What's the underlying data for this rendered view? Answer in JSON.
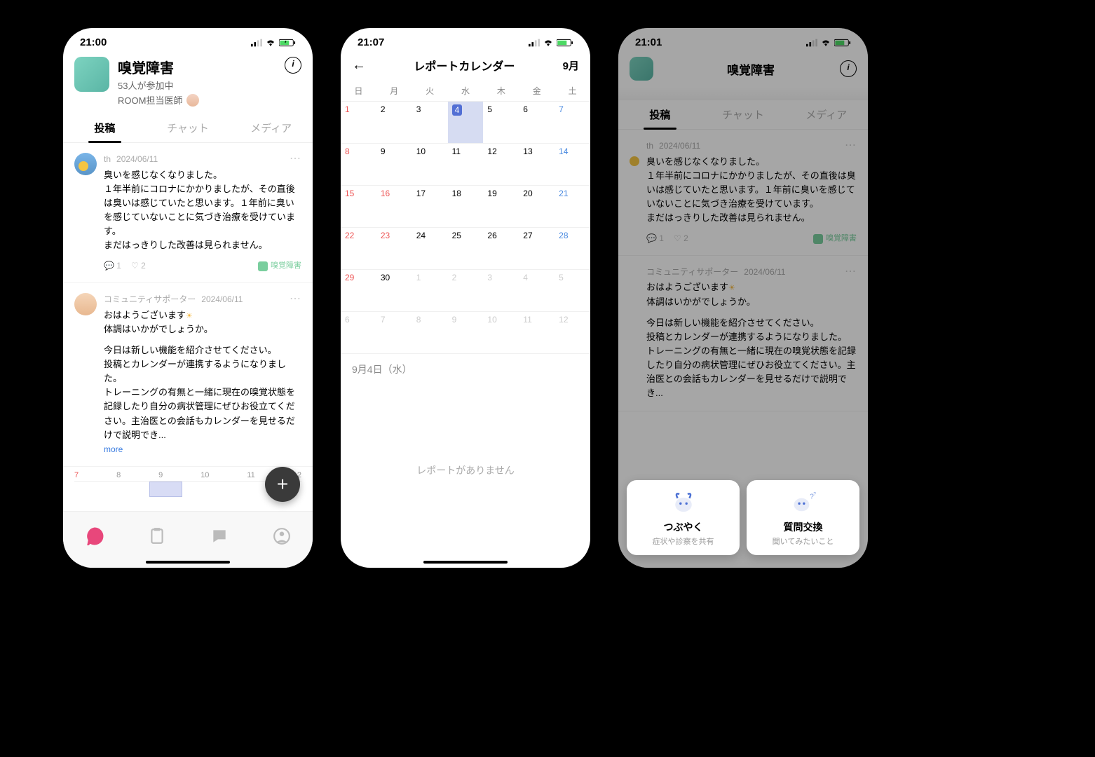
{
  "screen1": {
    "time": "21:00",
    "header": {
      "title": "嗅覚障害",
      "participants": "53人が参加中",
      "doctor_label": "ROOM担当医師"
    },
    "tabs": {
      "posts": "投稿",
      "chat": "チャット",
      "media": "メディア"
    },
    "post1": {
      "author": "th",
      "date": "2024/06/11",
      "line1": "臭いを感じなくなりました。",
      "line2": "１年半前にコロナにかかりましたが、その直後は臭いは感じていたと思います。１年前に臭いを感じていないことに気づき治療を受けています。",
      "line3": "まだはっきりした改善は見られません。",
      "comments": "1",
      "likes": "2",
      "tag": "嗅覚障害"
    },
    "post2": {
      "author": "コミュニティサポーター",
      "date": "2024/06/11",
      "greet": "おはようございます",
      "line2": "体調はいかがでしょうか。",
      "line3": "今日は新しい機能を紹介させてください。",
      "line4": "投稿とカレンダーが連携するようになりました。",
      "line5": "トレーニングの有無と一緒に現在の嗅覚状態を記録したり自分の病状管理にぜひお役立てください。主治医との会話もカレンダーを見せるだけで説明でき...",
      "more": "more"
    },
    "mini_cal": [
      "7",
      "8",
      "9",
      "10",
      "11",
      "12"
    ]
  },
  "screen2": {
    "time": "21:07",
    "title": "レポートカレンダー",
    "month": "9月",
    "dow": [
      "日",
      "月",
      "火",
      "水",
      "木",
      "金",
      "土"
    ],
    "weeks": [
      [
        {
          "n": "1",
          "c": "red"
        },
        {
          "n": "2"
        },
        {
          "n": "3"
        },
        {
          "n": "4",
          "sel": true
        },
        {
          "n": "5"
        },
        {
          "n": "6"
        },
        {
          "n": "7",
          "c": "blue"
        }
      ],
      [
        {
          "n": "8",
          "c": "red"
        },
        {
          "n": "9"
        },
        {
          "n": "10"
        },
        {
          "n": "11"
        },
        {
          "n": "12"
        },
        {
          "n": "13"
        },
        {
          "n": "14",
          "c": "blue"
        }
      ],
      [
        {
          "n": "15",
          "c": "red"
        },
        {
          "n": "16",
          "c": "red"
        },
        {
          "n": "17"
        },
        {
          "n": "18"
        },
        {
          "n": "19"
        },
        {
          "n": "20"
        },
        {
          "n": "21",
          "c": "blue"
        }
      ],
      [
        {
          "n": "22",
          "c": "red"
        },
        {
          "n": "23",
          "c": "red"
        },
        {
          "n": "24"
        },
        {
          "n": "25"
        },
        {
          "n": "26"
        },
        {
          "n": "27"
        },
        {
          "n": "28",
          "c": "blue"
        }
      ],
      [
        {
          "n": "29",
          "c": "red"
        },
        {
          "n": "30"
        },
        {
          "n": "1",
          "c": "gray"
        },
        {
          "n": "2",
          "c": "gray"
        },
        {
          "n": "3",
          "c": "gray"
        },
        {
          "n": "4",
          "c": "gray"
        },
        {
          "n": "5",
          "c": "blue gray"
        }
      ],
      [
        {
          "n": "6",
          "c": "gray"
        },
        {
          "n": "7",
          "c": "gray"
        },
        {
          "n": "8",
          "c": "gray"
        },
        {
          "n": "9",
          "c": "gray"
        },
        {
          "n": "10",
          "c": "gray"
        },
        {
          "n": "11",
          "c": "gray"
        },
        {
          "n": "12",
          "c": "blue gray"
        }
      ]
    ],
    "selected_date": "9月4日（水）",
    "empty": "レポートがありません"
  },
  "screen3": {
    "time": "21:01",
    "header_title": "嗅覚障害",
    "tabs": {
      "posts": "投稿",
      "chat": "チャット",
      "media": "メディア"
    },
    "post1": {
      "author": "th",
      "date": "2024/06/11",
      "line1": "臭いを感じなくなりました。",
      "line2": "１年半前にコロナにかかりましたが、その直後は臭いは感じていたと思います。１年前に臭いを感じていないことに気づき治療を受けています。",
      "line3": "まだはっきりした改善は見られません。",
      "comments": "1",
      "likes": "2",
      "tag": "嗅覚障害"
    },
    "post2": {
      "author": "コミュニティサポーター",
      "date": "2024/06/11",
      "greet": "おはようございます",
      "line2": "体調はいかがでしょうか。",
      "line3": "今日は新しい機能を紹介させてください。",
      "line4": "投稿とカレンダーが連携するようになりました。",
      "line5": "トレーニングの有無と一緒に現在の嗅覚状態を記録したり自分の病状管理にぜひお役立てください。主治医との会話もカレンダーを見せるだけで説明でき..."
    },
    "action1": {
      "title": "つぶやく",
      "sub": "症状や診察を共有"
    },
    "action2": {
      "title": "質問交換",
      "sub": "聞いてみたいこと"
    }
  }
}
